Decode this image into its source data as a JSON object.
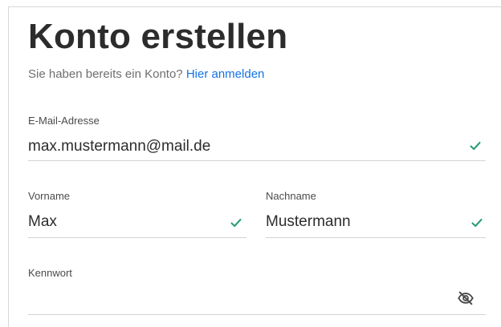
{
  "header": {
    "title": "Konto erstellen",
    "have_account_text": "Sie haben bereits ein Konto?",
    "signin_link": "Hier anmelden"
  },
  "form": {
    "email": {
      "label": "E-Mail-Adresse",
      "value": "max.mustermann@mail.de",
      "valid_icon": "check-icon"
    },
    "first_name": {
      "label": "Vorname",
      "value": "Max",
      "valid_icon": "check-icon"
    },
    "last_name": {
      "label": "Nachname",
      "value": "Mustermann",
      "valid_icon": "check-icon"
    },
    "password": {
      "label": "Kennwort",
      "value": "",
      "toggle_icon": "eye-slash-icon"
    }
  },
  "colors": {
    "link": "#1473e6",
    "success": "#2d9d78",
    "text": "#2c2c2c",
    "muted": "#6e6e6e",
    "divider": "#d3d3d3"
  }
}
